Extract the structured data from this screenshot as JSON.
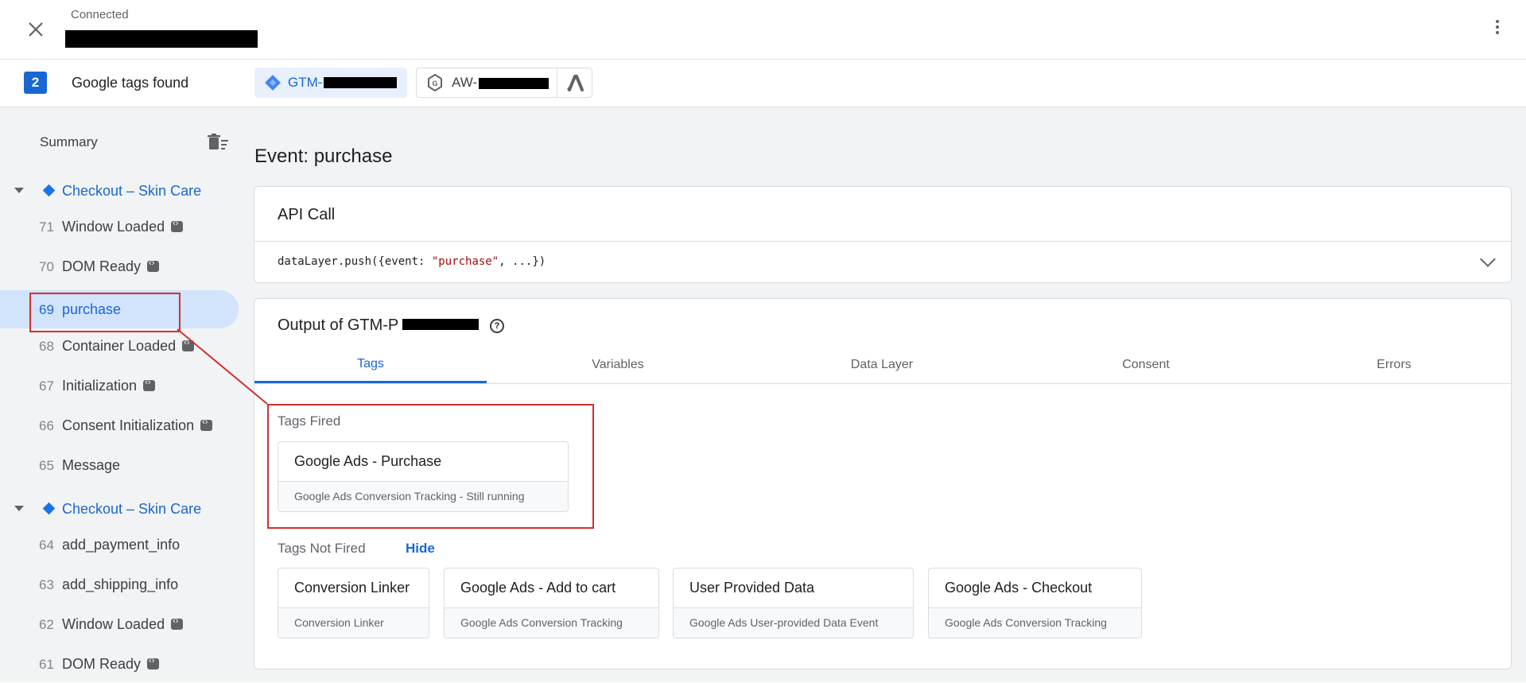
{
  "header": {
    "status": "Connected"
  },
  "tags_bar": {
    "count": "2",
    "label": "Google tags found",
    "gtm_chip": "GTM-",
    "aw_chip": "AW-"
  },
  "sidebar": {
    "summary": "Summary",
    "groups": [
      {
        "name": "Checkout – Skin Care",
        "events": [
          {
            "num": "71",
            "name": "Window Loaded"
          },
          {
            "num": "70",
            "name": "DOM Ready"
          },
          {
            "num": "69",
            "name": "purchase"
          },
          {
            "num": "68",
            "name": "Container Loaded"
          },
          {
            "num": "67",
            "name": "Initialization"
          },
          {
            "num": "66",
            "name": "Consent Initialization"
          },
          {
            "num": "65",
            "name": "Message"
          }
        ]
      },
      {
        "name": "Checkout – Skin Care",
        "events": [
          {
            "num": "64",
            "name": "add_payment_info"
          },
          {
            "num": "63",
            "name": "add_shipping_info"
          },
          {
            "num": "62",
            "name": "Window Loaded"
          },
          {
            "num": "61",
            "name": "DOM Ready"
          }
        ]
      }
    ]
  },
  "main": {
    "event_title": "Event: purchase",
    "api_call": {
      "title": "API Call",
      "code_prefix": "dataLayer.push({event: ",
      "code_string": "\"purchase\"",
      "code_suffix": ", ...})"
    },
    "output": {
      "title": "Output of GTM-P",
      "tabs": [
        "Tags",
        "Variables",
        "Data Layer",
        "Consent",
        "Errors"
      ],
      "tags_fired_label": "Tags Fired",
      "tags_fired": [
        {
          "name": "Google Ads - Purchase",
          "type": "Google Ads Conversion Tracking - Still running"
        }
      ],
      "tags_not_fired_label": "Tags Not Fired",
      "hide_label": "Hide",
      "tags_not_fired": [
        {
          "name": "Conversion Linker",
          "type": "Conversion Linker"
        },
        {
          "name": "Google Ads - Add to cart",
          "type": "Google Ads Conversion Tracking"
        },
        {
          "name": "User Provided Data",
          "type": "Google Ads User-provided Data Event"
        },
        {
          "name": "Google Ads - Checkout",
          "type": "Google Ads Conversion Tracking"
        }
      ]
    }
  },
  "colors": {
    "accent": "#1967d2",
    "highlight_box": "#d32f2f"
  }
}
